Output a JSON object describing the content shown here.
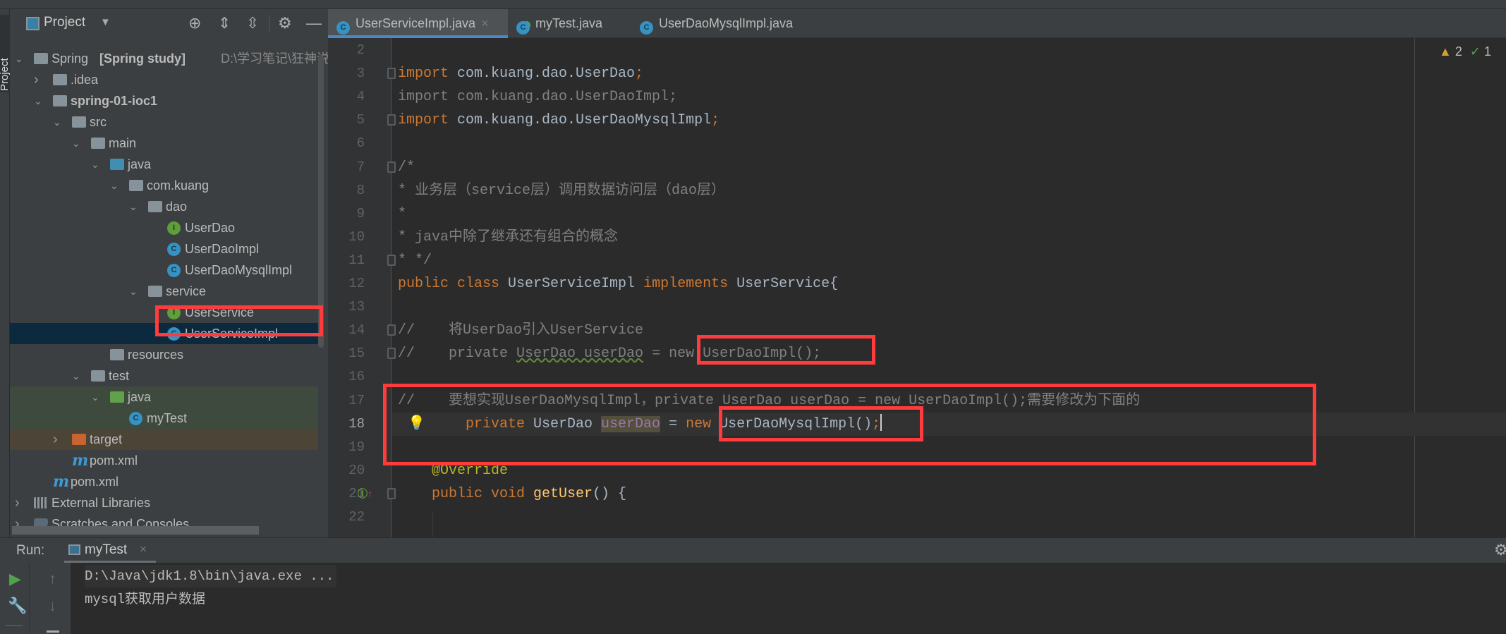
{
  "colors": {
    "accent": "#4a88c7",
    "highlight_box": "#ff3b3b",
    "keyword": "#cc7832",
    "comment": "#808080",
    "annotation": "#bbb529"
  },
  "side_strip": {
    "label": "Project"
  },
  "project_panel": {
    "title": "Project",
    "dropdown_icon": "triangle-down-icon",
    "toolbar_icons": [
      "locate-icon",
      "expand-all-icon",
      "collapse-all-icon",
      "gear-icon",
      "minimize-icon"
    ],
    "tree": [
      {
        "label": "Spring",
        "bold_suffix": "[Spring study]",
        "path": "D:\\学习笔记\\狂神说Jav",
        "depth": 0,
        "icon": "module",
        "expanded": true
      },
      {
        "label": ".idea",
        "depth": 1,
        "icon": "folder",
        "expanded": false
      },
      {
        "label": "spring-01-ioc1",
        "depth": 1,
        "icon": "module",
        "expanded": true,
        "bold": true
      },
      {
        "label": "src",
        "depth": 2,
        "icon": "folder",
        "expanded": true
      },
      {
        "label": "main",
        "depth": 3,
        "icon": "folder",
        "expanded": true
      },
      {
        "label": "java",
        "depth": 4,
        "icon": "folder-blue",
        "expanded": true
      },
      {
        "label": "com.kuang",
        "depth": 5,
        "icon": "package",
        "expanded": true
      },
      {
        "label": "dao",
        "depth": 6,
        "icon": "package",
        "expanded": true
      },
      {
        "label": "UserDao",
        "depth": 7,
        "icon": "interface"
      },
      {
        "label": "UserDaoImpl",
        "depth": 7,
        "icon": "class"
      },
      {
        "label": "UserDaoMysqlImpl",
        "depth": 7,
        "icon": "class"
      },
      {
        "label": "service",
        "depth": 6,
        "icon": "package",
        "expanded": true
      },
      {
        "label": "UserService",
        "depth": 7,
        "icon": "interface"
      },
      {
        "label": "UserServiceImpl",
        "depth": 7,
        "icon": "class",
        "selected": true
      },
      {
        "label": "resources",
        "depth": 4,
        "icon": "folder"
      },
      {
        "label": "test",
        "depth": 3,
        "icon": "folder",
        "expanded": true
      },
      {
        "label": "java",
        "depth": 4,
        "icon": "folder-green",
        "expanded": true,
        "band": "green"
      },
      {
        "label": "myTest",
        "depth": 5,
        "icon": "class",
        "band": "green"
      },
      {
        "label": "target",
        "depth": 2,
        "icon": "folder-orange",
        "expanded": false,
        "band": "brown"
      },
      {
        "label": "pom.xml",
        "depth": 2,
        "icon": "maven"
      },
      {
        "label": "pom.xml",
        "depth": 1,
        "icon": "maven"
      },
      {
        "label": "External Libraries",
        "depth": 0,
        "icon": "libraries",
        "expanded": false
      },
      {
        "label": "Scratches and Consoles",
        "depth": 0,
        "icon": "scratches",
        "expanded": false
      }
    ]
  },
  "tabs": [
    {
      "label": "UserServiceImpl.java",
      "active": true,
      "closable": true
    },
    {
      "label": "myTest.java",
      "active": false
    },
    {
      "label": "UserDaoMysqlImpl.java",
      "active": false
    }
  ],
  "inspections": {
    "warnings": "2",
    "weak_warnings": "1"
  },
  "editor": {
    "current_line": 18,
    "lines": [
      {
        "n": "2",
        "tokens": []
      },
      {
        "n": "3",
        "fold": true,
        "tokens": [
          {
            "t": "import",
            "c": "kw"
          },
          {
            "t": " com.kuang.dao.UserDao",
            "c": "id"
          },
          {
            "t": ";",
            "c": "pu"
          }
        ]
      },
      {
        "n": "4",
        "tokens": [
          {
            "t": "import com.kuang.dao.UserDaoImpl;",
            "c": "gr"
          }
        ]
      },
      {
        "n": "5",
        "fold": true,
        "tokens": [
          {
            "t": "import",
            "c": "kw"
          },
          {
            "t": " com.kuang.dao.UserDaoMysqlImpl",
            "c": "id"
          },
          {
            "t": ";",
            "c": "pu"
          }
        ]
      },
      {
        "n": "6",
        "tokens": []
      },
      {
        "n": "7",
        "fold": true,
        "tokens": [
          {
            "t": "/*",
            "c": "cm"
          }
        ]
      },
      {
        "n": "8",
        "tokens": [
          {
            "t": "* 业务层（service层）调用数据访问层（dao层）",
            "c": "cm"
          }
        ]
      },
      {
        "n": "9",
        "tokens": [
          {
            "t": "*",
            "c": "cm"
          }
        ]
      },
      {
        "n": "10",
        "tokens": [
          {
            "t": "* java中除了继承还有组合的概念",
            "c": "cm"
          }
        ]
      },
      {
        "n": "11",
        "fold": true,
        "tokens": [
          {
            "t": "* */",
            "c": "cm"
          }
        ]
      },
      {
        "n": "12",
        "tokens": [
          {
            "t": "public class ",
            "c": "kw"
          },
          {
            "t": "UserServiceImpl ",
            "c": "id"
          },
          {
            "t": "implements ",
            "c": "kw"
          },
          {
            "t": "UserService{",
            "c": "id"
          }
        ]
      },
      {
        "n": "13",
        "tokens": []
      },
      {
        "n": "14",
        "fold": true,
        "tokens": [
          {
            "t": "//    将UserDao引入UserService",
            "c": "cm"
          }
        ]
      },
      {
        "n": "15",
        "fold": true,
        "tokens": [
          {
            "t": "//    private ",
            "c": "cm"
          },
          {
            "t": "UserDao userDao",
            "c": "cm wavy"
          },
          {
            "t": " = new UserDaoImpl();",
            "c": "cm"
          }
        ]
      },
      {
        "n": "16",
        "tokens": []
      },
      {
        "n": "17",
        "tokens": [
          {
            "t": "//    要想实现UserDaoMysqlImpl，private UserDao userDao = new UserDaoImpl();需要修改为下面的",
            "c": "cm"
          }
        ]
      },
      {
        "n": "18",
        "bulb": true,
        "tokens": [
          {
            "t": "        private ",
            "c": "kw"
          },
          {
            "t": "UserDao ",
            "c": "id"
          },
          {
            "t": "userDao",
            "c": "fld"
          },
          {
            "t": " = ",
            "c": "id"
          },
          {
            "t": "new ",
            "c": "kw"
          },
          {
            "t": "UserDaoMysqlImpl()",
            "c": "id"
          },
          {
            "t": ";",
            "c": "pu"
          }
        ]
      },
      {
        "n": "19",
        "tokens": []
      },
      {
        "n": "20",
        "tokens": [
          {
            "t": "    @Override",
            "c": "an"
          }
        ]
      },
      {
        "n": "21",
        "fold": true,
        "impl": true,
        "tokens": [
          {
            "t": "    public void ",
            "c": "kw"
          },
          {
            "t": "getUser",
            "c": "fn"
          },
          {
            "t": "() {",
            "c": "id"
          }
        ]
      },
      {
        "n": "22",
        "tokens": []
      }
    ]
  },
  "run_panel": {
    "label": "Run:",
    "tab": "myTest",
    "output": [
      "D:\\Java\\jdk1.8\\bin\\java.exe ...",
      "mysql获取用户数据"
    ],
    "icons": [
      "run-icon",
      "wrench-icon",
      "up-arrow-icon",
      "down-arrow-icon",
      "gear-icon"
    ]
  }
}
